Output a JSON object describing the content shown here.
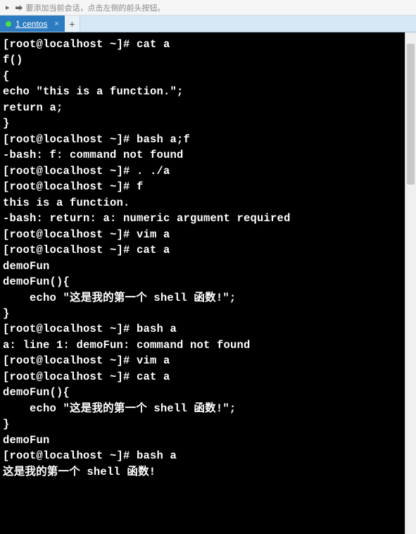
{
  "toolbar": {
    "hint": "要添加当前会话，点击左侧的前头按钮。"
  },
  "tabs": {
    "active": {
      "label": "1 centos"
    }
  },
  "terminal": {
    "lines": [
      "[root@localhost ~]# cat a",
      "f()",
      "{",
      "echo \"this is a function.\";",
      "return a;",
      "}",
      "[root@localhost ~]# bash a;f",
      "-bash: f: command not found",
      "[root@localhost ~]# . ./a",
      "[root@localhost ~]# f",
      "this is a function.",
      "-bash: return: a: numeric argument required",
      "[root@localhost ~]# vim a",
      "[root@localhost ~]# cat a",
      "demoFun",
      "demoFun(){",
      "    echo \"这是我的第一个 shell 函数!\";",
      "}",
      "[root@localhost ~]# bash a",
      "a: line 1: demoFun: command not found",
      "[root@localhost ~]# vim a",
      "[root@localhost ~]# cat a",
      "demoFun(){",
      "    echo \"这是我的第一个 shell 函数!\";",
      "}",
      "demoFun",
      "[root@localhost ~]# bash a",
      "这是我的第一个 shell 函数!"
    ]
  },
  "colors": {
    "tab_bg": "#2d7cc1",
    "tab_dot": "#4ade4a",
    "terminal_bg": "#000000",
    "terminal_fg": "#ffffff"
  }
}
